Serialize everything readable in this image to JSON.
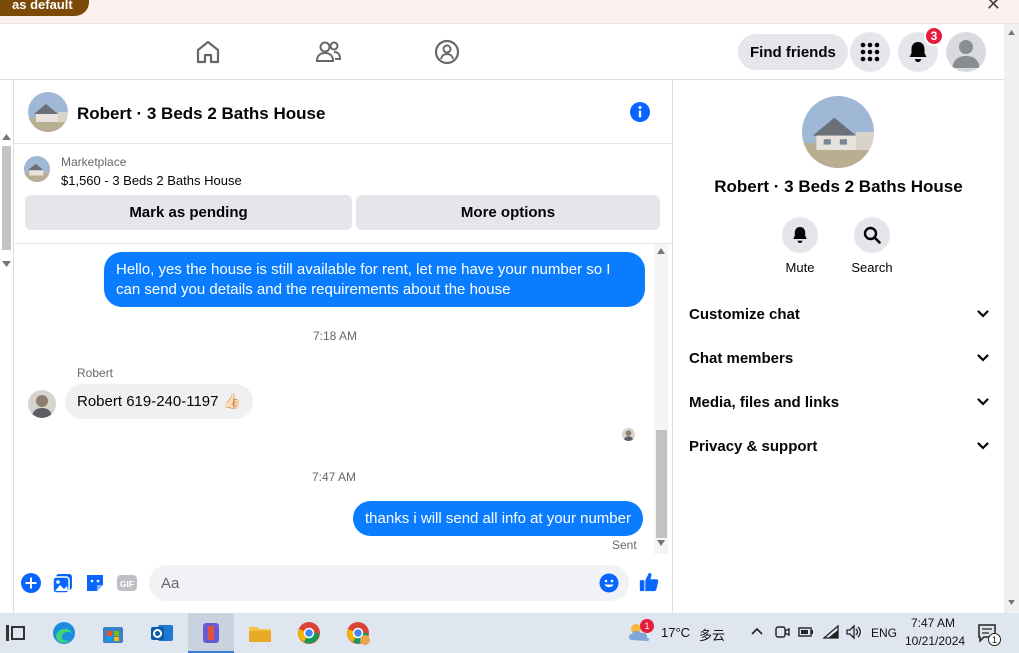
{
  "banner": {
    "pill_label": "as default",
    "close_glyph": "✕"
  },
  "navbar": {
    "find_friends": "Find friends",
    "notification_count": "3"
  },
  "chat": {
    "title": "Robert · 3 Beds 2 Baths House",
    "marketplace_label": "Marketplace",
    "listing": "$1,560 - 3 Beds 2 Baths House",
    "mark_pending": "Mark as pending",
    "more_options": "More options",
    "messages": [
      {
        "text": "Hello, yes the house is still available for rent, let me have your number so I can send you details and the requirements about the house"
      },
      {
        "time": "7:18 AM"
      },
      {
        "sender": "Robert",
        "text": "Robert 619-240-1197 👍🏻"
      },
      {
        "time": "7:47 AM"
      },
      {
        "text": "thanks i will send all info at your number",
        "status": "Sent"
      }
    ],
    "composer_placeholder": "Aa"
  },
  "right_panel": {
    "title": "Robert · 3 Beds 2 Baths House",
    "actions": [
      {
        "label": "Mute"
      },
      {
        "label": "Search"
      }
    ],
    "sections": [
      {
        "label": "Customize chat"
      },
      {
        "label": "Chat members"
      },
      {
        "label": "Media, files and links"
      },
      {
        "label": "Privacy & support"
      }
    ]
  },
  "taskbar": {
    "weather_temp": "17°C",
    "weather_desc": "多云",
    "weather_badge": "1",
    "language": "ENG",
    "time": "7:47 AM",
    "date": "10/21/2024",
    "notif_count": "1"
  },
  "colors": {
    "messenger_blue": "#0a7cff",
    "accent": "#0866ff",
    "badge_red": "#e41e3f"
  }
}
